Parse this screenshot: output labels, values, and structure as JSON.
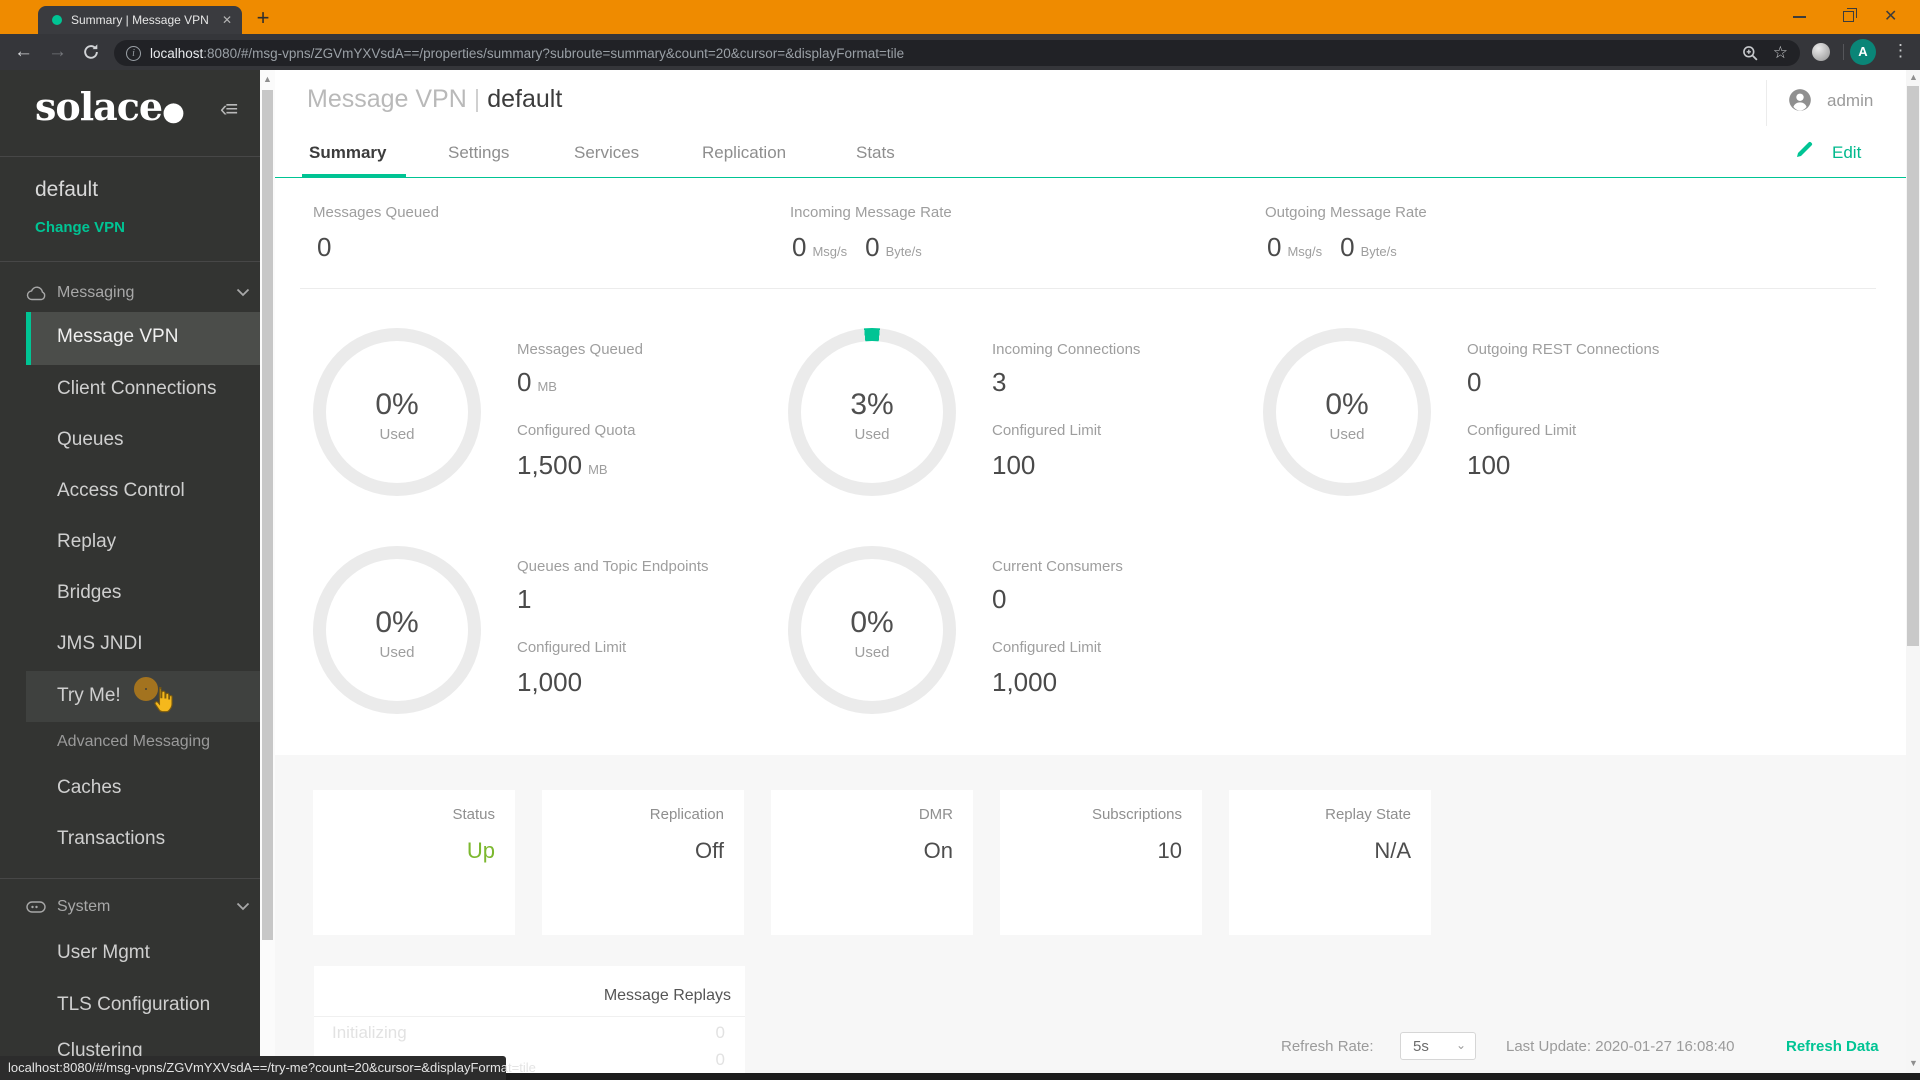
{
  "browser": {
    "tab_title": "Summary | Message VPN",
    "new_tab_button": "+",
    "url_host": "localhost",
    "url_rest": ":8080/#/msg-vpns/ZGVmYXVsdA==/properties/summary?subroute=summary&count=20&cursor=&displayFormat=tile",
    "avatar_letter": "A"
  },
  "sidebar": {
    "logo": "solace",
    "vpn_name": "default",
    "change_vpn": "Change VPN",
    "sections": [
      {
        "label": "Messaging",
        "items": [
          {
            "label": "Message VPN"
          },
          {
            "label": "Client Connections"
          },
          {
            "label": "Queues"
          },
          {
            "label": "Access Control"
          },
          {
            "label": "Replay"
          },
          {
            "label": "Bridges"
          },
          {
            "label": "JMS JNDI"
          },
          {
            "label": "Try Me!"
          },
          {
            "label": "Advanced Messaging"
          },
          {
            "label": "Caches"
          },
          {
            "label": "Transactions"
          }
        ]
      },
      {
        "label": "System",
        "items": [
          {
            "label": "User Mgmt"
          },
          {
            "label": "TLS Configuration"
          },
          {
            "label": "Clustering"
          }
        ]
      }
    ]
  },
  "header": {
    "title_prefix": "Message VPN",
    "title_name": "default",
    "user": "admin"
  },
  "tabs": {
    "items": [
      "Summary",
      "Settings",
      "Services",
      "Replication",
      "Stats"
    ],
    "active": "Summary",
    "edit_label": "Edit"
  },
  "stats_row": {
    "messages_queued_label": "Messages Queued",
    "messages_queued_value": "0",
    "incoming_label": "Incoming Message Rate",
    "incoming_msg_value": "0",
    "incoming_msg_unit": "Msg/s",
    "incoming_byte_value": "0",
    "incoming_byte_unit": "Byte/s",
    "outgoing_label": "Outgoing Message Rate",
    "outgoing_msg_value": "0",
    "outgoing_msg_unit": "Msg/s",
    "outgoing_byte_value": "0",
    "outgoing_byte_unit": "Byte/s"
  },
  "gauges": [
    {
      "percent": "0%",
      "used": "Used",
      "pct": 0,
      "title": "Messages Queued",
      "value": "0",
      "unit": "MB",
      "limit_label": "Configured Quota",
      "limit_value": "1,500",
      "limit_unit": "MB"
    },
    {
      "percent": "3%",
      "used": "Used",
      "pct": 3,
      "title": "Incoming Connections",
      "value": "3",
      "unit": "",
      "limit_label": "Configured Limit",
      "limit_value": "100",
      "limit_unit": ""
    },
    {
      "percent": "0%",
      "used": "Used",
      "pct": 0,
      "title": "Outgoing REST Connections",
      "value": "0",
      "unit": "",
      "limit_label": "Configured Limit",
      "limit_value": "100",
      "limit_unit": ""
    },
    {
      "percent": "0%",
      "used": "Used",
      "pct": 0,
      "title": "Queues and Topic Endpoints",
      "value": "1",
      "unit": "",
      "limit_label": "Configured Limit",
      "limit_value": "1,000",
      "limit_unit": ""
    },
    {
      "percent": "0%",
      "used": "Used",
      "pct": 0,
      "title": "Current Consumers",
      "value": "0",
      "unit": "",
      "limit_label": "Configured Limit",
      "limit_value": "1,000",
      "limit_unit": ""
    }
  ],
  "status_tiles": [
    {
      "label": "Status",
      "value": "Up"
    },
    {
      "label": "Replication",
      "value": "Off"
    },
    {
      "label": "DMR",
      "value": "On"
    },
    {
      "label": "Subscriptions",
      "value": "10"
    },
    {
      "label": "Replay State",
      "value": "N/A"
    }
  ],
  "replay_card": {
    "title": "Message Replays",
    "rows": [
      {
        "label": "Initializing",
        "value": "0"
      },
      {
        "label": "",
        "value": "0"
      }
    ]
  },
  "footer": {
    "refresh_rate_label": "Refresh Rate:",
    "refresh_rate_value": "5s",
    "last_update": "Last Update: 2020-01-27 16:08:40",
    "refresh_button": "Refresh Data"
  },
  "statusbar": {
    "link_preview": "localhost:8080/#/msg-vpns/ZGVmYXVsdA==/try-me?count=20&cursor=&displayFormat=tile"
  },
  "colors": {
    "accent_green": "#00c494",
    "brand_orange": "#ef8b00",
    "status_up_green": "#7cb82f",
    "sidebar_bg": "#333432",
    "toolbar_bg": "#35363a",
    "page_bg": "#f7f7f7"
  }
}
